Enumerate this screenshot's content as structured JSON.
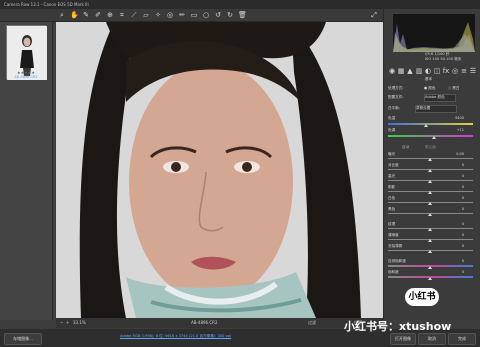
{
  "window": {
    "title": "Camera Raw 13.1 - Canon EOS 5D Mark III"
  },
  "filmstrip": {
    "thumb_label": "AB-4896.CR2",
    "stars": "★★★★★"
  },
  "status": {
    "zoom": "33.1%",
    "filename": "AB-4896.CR2",
    "filter_label": "过滤",
    "sort_label": "排序"
  },
  "histogram": {
    "readout_line1": "f/5.6  1/100 秒",
    "readout_line2": "ISO 100  50-100 毫米"
  },
  "panel": {
    "section": "基本",
    "treatment_label": "处理方式:",
    "treatment_color": "颜色",
    "treatment_bw": "黑白",
    "profile_label": "配置文件:",
    "profile_value": "Adobe 颜色",
    "wb_label": "白平衡:",
    "wb_value": "原照设置",
    "temp_label": "色温",
    "temp_value": "5400",
    "tint_label": "色调",
    "tint_value": "+11",
    "auto_label": "自动",
    "default_label": "默认值",
    "rows": [
      {
        "label": "曝光",
        "value": "0.00"
      },
      {
        "label": "对比度",
        "value": "0"
      },
      {
        "label": "高光",
        "value": "0"
      },
      {
        "label": "阴影",
        "value": "0"
      },
      {
        "label": "白色",
        "value": "0"
      },
      {
        "label": "黑色",
        "value": "0"
      },
      {
        "label": "纹理",
        "value": "0"
      },
      {
        "label": "清晰度",
        "value": "0"
      },
      {
        "label": "去除薄雾",
        "value": "0"
      },
      {
        "label": "自然饱和度",
        "value": "0"
      },
      {
        "label": "饱和度",
        "value": "0"
      }
    ]
  },
  "footer": {
    "save_button": "存储图像...",
    "info": "Adobe RGB (1998); 8 位; 5616 x 3744 (21.0 百万像素); 300 ppi",
    "open_button": "打开图像",
    "cancel_button": "取消",
    "done_button": "完成"
  },
  "watermark": {
    "badge": "小红书",
    "text": "小红书号：xtushow"
  },
  "colors": {
    "panel": "#3b3b3b",
    "canvas": "#d8d8d8",
    "accent": "#4a7ad8"
  }
}
